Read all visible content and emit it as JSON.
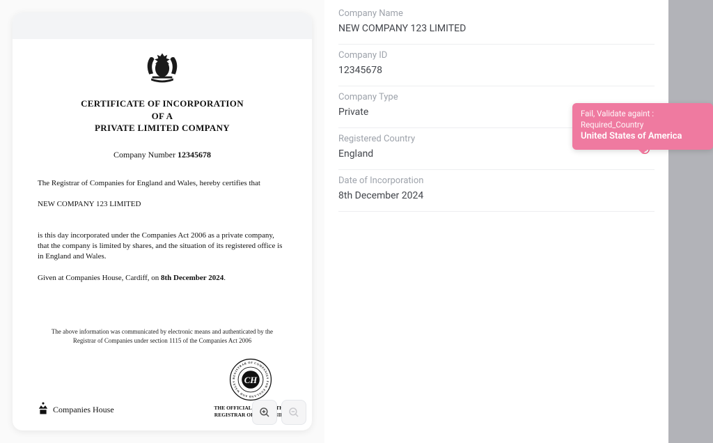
{
  "document": {
    "title_line1": "CERTIFICATE OF INCORPORATION",
    "title_line2": "OF A",
    "title_line3": "PRIVATE LIMITED COMPANY",
    "company_number_label": "Company Number",
    "company_number": "12345678",
    "registrar_line": "The Registrar of Companies for England and Wales, hereby certifies that",
    "company_name": "NEW COMPANY 123 LIMITED",
    "incorporation_para": "is this day incorporated under the Companies Act 2006 as a private company, that the company is limited by shares, and the situation of its registered office is in England and Wales.",
    "given_at_prefix": "Given at Companies House, Cardiff, on ",
    "given_at_date": "8th December 2024",
    "given_at_suffix": ".",
    "footer_note_line1": "The above information was communicated by electronic means and authenticated by the",
    "footer_note_line2": "Registrar of Companies under section 1115 of the Companies Act 2006",
    "companies_house_label": "Companies House",
    "seal_ring_text": "REGISTRAR OF COMPANIES FOR ENGLAND AND WALES",
    "seal_center": "CH",
    "seal_caption_line1": "THE OFFICIAL SEAL OF THE",
    "seal_caption_line2": "REGISTRAR OF COMPANIES"
  },
  "panel": {
    "fields": {
      "company_name": {
        "label": "Company Name",
        "value": "NEW COMPANY 123 LIMITED"
      },
      "company_id": {
        "label": "Company ID",
        "value": "12345678"
      },
      "company_type": {
        "label": "Company Type",
        "value": "Private"
      },
      "registered_country": {
        "label": "Registered Country",
        "value": "England",
        "has_error": true
      },
      "date_of_incorporation": {
        "label": "Date of Incorporation",
        "value": "8th December 2024"
      }
    }
  },
  "tooltip": {
    "line1": "Fail, Validate againt : Required_Country",
    "line2": "United States of America"
  }
}
